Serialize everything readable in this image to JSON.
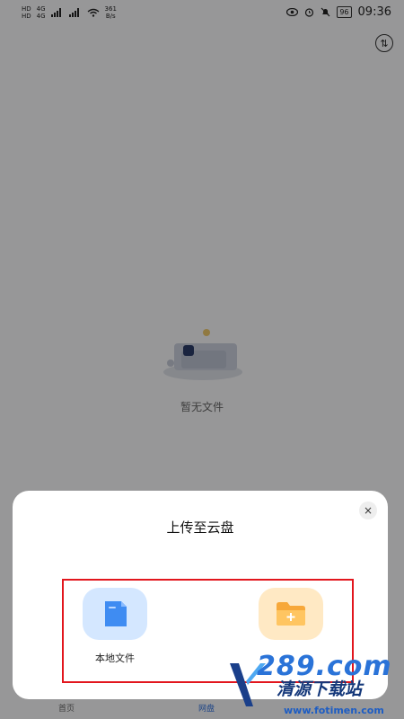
{
  "status_bar": {
    "sim_labels": [
      "HD",
      "HD"
    ],
    "network_labels": [
      "4G",
      "4G"
    ],
    "speed_value": "361",
    "speed_unit": "B/s",
    "battery": "96",
    "time": "09:36"
  },
  "page": {
    "empty_state_text": "暂无文件"
  },
  "tab_bar": {
    "items": [
      {
        "label": "首页"
      },
      {
        "label": "网盘"
      }
    ]
  },
  "upload_sheet": {
    "title": "上传至云盘",
    "close_label": "×",
    "options": [
      {
        "label": "本地文件",
        "icon": "document-icon"
      },
      {
        "label": "",
        "icon": "folder-add-icon"
      }
    ]
  },
  "watermark": {
    "brand": "289.com",
    "name": "清源下载站",
    "url": "www.fotimen.com"
  },
  "colors": {
    "accent": "#2f6fd8",
    "highlight": "#e2161d",
    "local_icon_bg": "#d4e7ff",
    "cloud_icon_bg": "#ffe9c4"
  }
}
